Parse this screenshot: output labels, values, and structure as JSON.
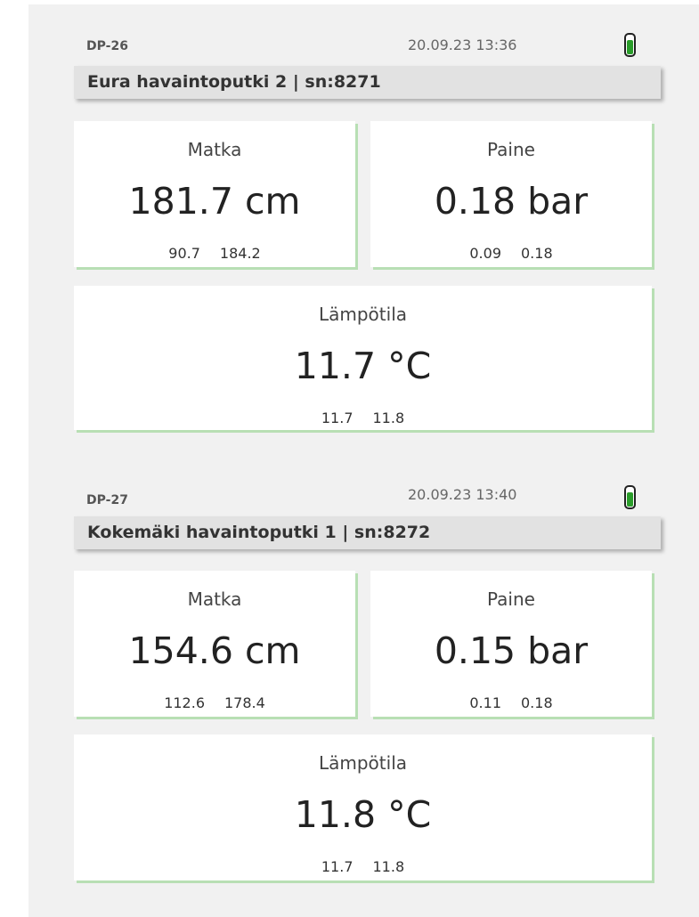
{
  "devices": [
    {
      "id": "DP-26",
      "timestamp": "20.09.23 13:36",
      "battery_level": 0.7,
      "battery_color": "#2a9d2a",
      "title": "Eura havaintoputki 2 | sn:8271",
      "tiles": {
        "distance": {
          "label": "Matka",
          "value": "181.7 cm",
          "min": "90.7",
          "max": "184.2"
        },
        "pressure": {
          "label": "Paine",
          "value": "0.18 bar",
          "min": "0.09",
          "max": "0.18"
        },
        "temperature": {
          "label": "Lämpötila",
          "value": "11.7 °C",
          "min": "11.7",
          "max": "11.8"
        }
      }
    },
    {
      "id": "DP-27",
      "timestamp": "20.09.23 13:40",
      "battery_level": 0.7,
      "battery_color": "#2a9d2a",
      "title": "Kokemäki havaintoputki 1 | sn:8272",
      "tiles": {
        "distance": {
          "label": "Matka",
          "value": "154.6 cm",
          "min": "112.6",
          "max": "178.4"
        },
        "pressure": {
          "label": "Paine",
          "value": "0.15 bar",
          "min": "0.11",
          "max": "0.18"
        },
        "temperature": {
          "label": "Lämpötila",
          "value": "11.8 °C",
          "min": "11.7",
          "max": "11.8"
        }
      }
    }
  ],
  "colors": {
    "panel_bg": "#f1f1f1",
    "titlebar_bg": "#e2e2e2",
    "tile_accent": "#b8dfb4"
  }
}
